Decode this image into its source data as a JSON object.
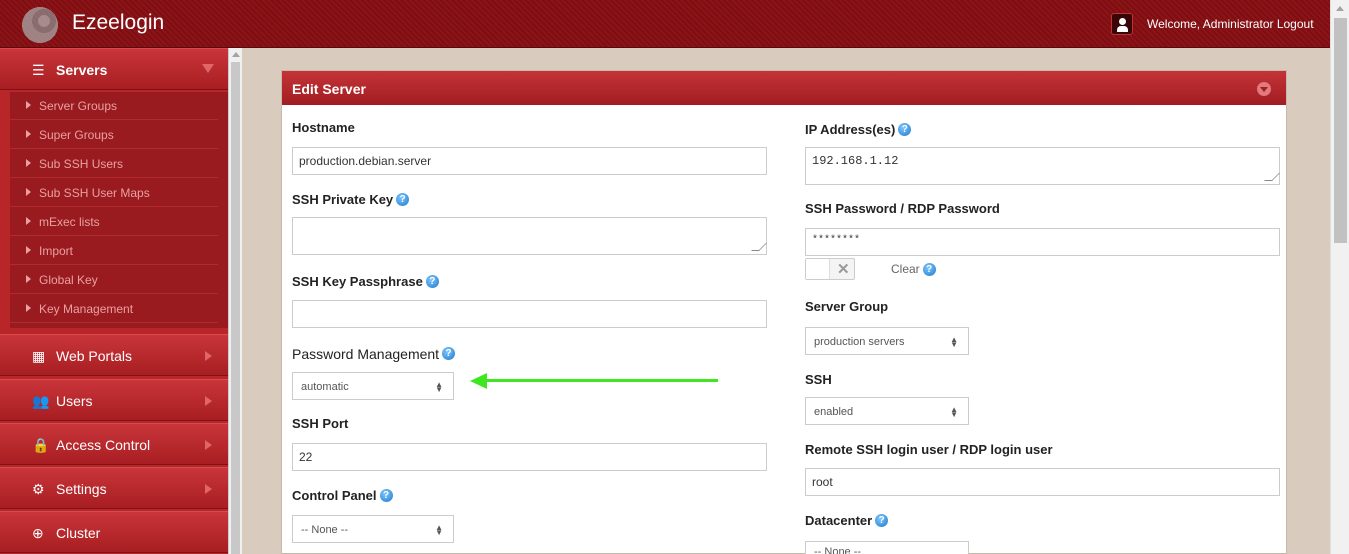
{
  "app": {
    "title": "Ezeelogin"
  },
  "header": {
    "welcome": "Welcome, Administrator Logout"
  },
  "sidebar": {
    "servers": {
      "label": "Servers",
      "expanded": true
    },
    "sub_items": [
      "Server Groups",
      "Super Groups",
      "Sub SSH Users",
      "Sub SSH User Maps",
      "mExec lists",
      "Import",
      "Global Key",
      "Key Management"
    ],
    "menus": [
      {
        "label": "Web Portals",
        "icon": "grid-icon"
      },
      {
        "label": "Users",
        "icon": "users-icon"
      },
      {
        "label": "Access Control",
        "icon": "lock-icon"
      },
      {
        "label": "Settings",
        "icon": "gears-icon"
      },
      {
        "label": "Cluster",
        "icon": "globe-icon"
      }
    ]
  },
  "panel": {
    "title": "Edit Server",
    "left": {
      "hostname_label": "Hostname",
      "hostname_value": "production.debian.server",
      "ssh_private_key_label": "SSH Private Key",
      "ssh_private_key_value": "",
      "ssh_key_passphrase_label": "SSH Key Passphrase",
      "ssh_key_passphrase_value": "",
      "password_management_label": "Password Management",
      "password_management_value": "automatic",
      "ssh_port_label": "SSH Port",
      "ssh_port_value": "22",
      "control_panel_label": "Control Panel",
      "control_panel_value": "-- None --"
    },
    "right": {
      "ip_label": "IP Address(es)",
      "ip_value": "192.168.1.12",
      "ssh_password_label": "SSH Password / RDP Password",
      "ssh_password_value": "********",
      "clear_label": "Clear",
      "server_group_label": "Server Group",
      "server_group_value": "production servers",
      "ssh_label": "SSH",
      "ssh_value": "enabled",
      "remote_user_label": "Remote SSH login user / RDP login user",
      "remote_user_value": "root",
      "datacenter_label": "Datacenter",
      "datacenter_value": "-- None --"
    }
  },
  "help_glyph": "?",
  "colors": {
    "accent_red": "#b8262a",
    "annotation_arrow": "#3ee71f"
  }
}
